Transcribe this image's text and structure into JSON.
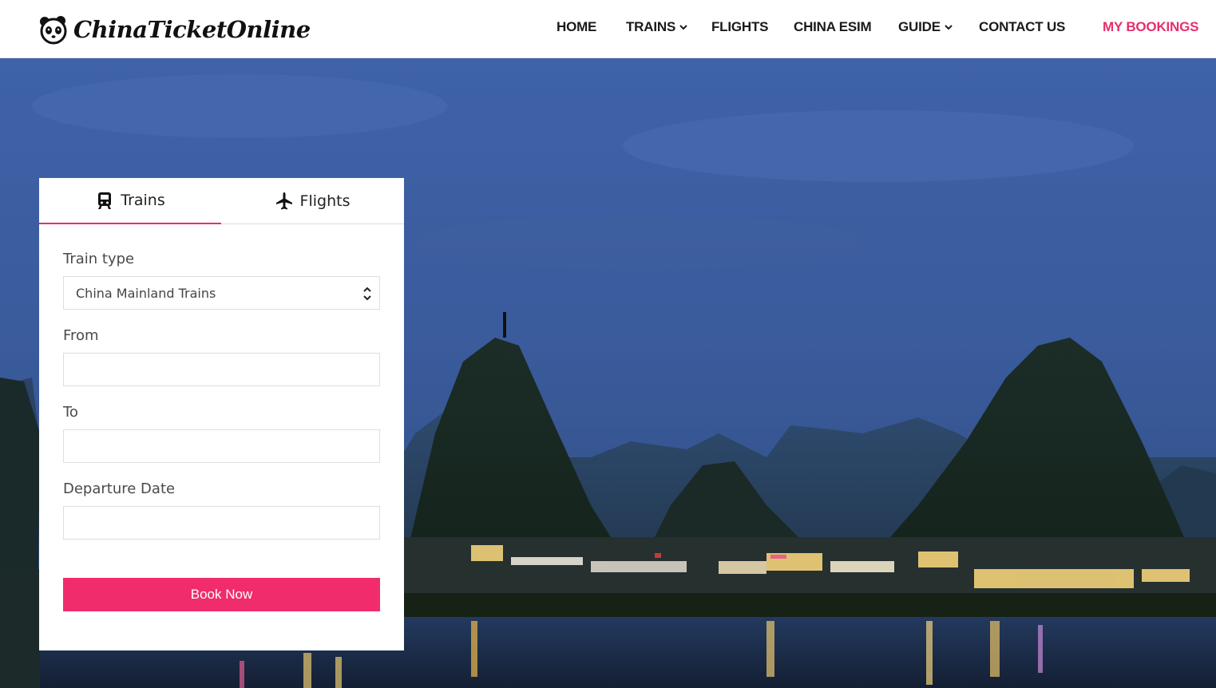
{
  "header": {
    "logo_text": "ChinaTicketOnline",
    "nav": [
      {
        "label": "HOME",
        "dropdown": false
      },
      {
        "label": "TRAINS",
        "dropdown": true
      },
      {
        "label": "FLIGHTS",
        "dropdown": false
      },
      {
        "label": "CHINA ESIM",
        "dropdown": false
      },
      {
        "label": "GUIDE",
        "dropdown": true
      },
      {
        "label": "CONTACT US",
        "dropdown": false
      }
    ],
    "my_bookings": "MY BOOKINGS"
  },
  "booking": {
    "tabs": {
      "trains": "Trains",
      "flights": "Flights",
      "active": "Trains"
    },
    "train_type_label": "Train type",
    "train_type_value": "China Mainland Trains",
    "from_label": "From",
    "from_value": "",
    "to_label": "To",
    "to_value": "",
    "departure_label": "Departure Date",
    "departure_value": "",
    "book_button": "Book Now"
  },
  "colors": {
    "accent": "#e72f6a",
    "button": "#f02c6c",
    "sky": "#3a5a9e"
  },
  "icons": {
    "trains_tab": "train-icon",
    "flights_tab": "airplane-icon",
    "select": "chevron-up-down-icon",
    "nav_dropdown": "chevron-down-icon"
  }
}
